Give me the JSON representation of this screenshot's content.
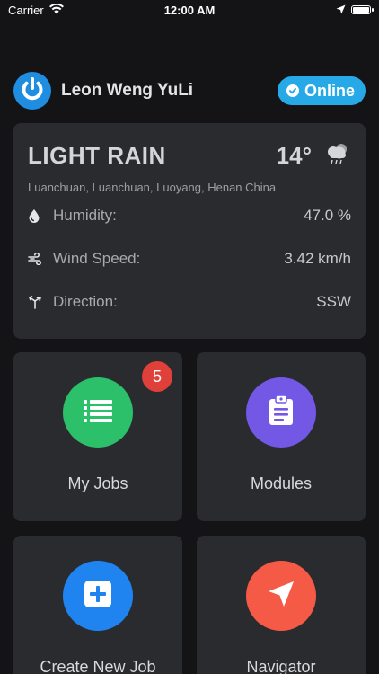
{
  "status_bar": {
    "carrier": "Carrier",
    "time": "12:00 AM",
    "battery_level": 1.0
  },
  "header": {
    "username": "Leon Weng YuLi",
    "status_label": "Online"
  },
  "weather": {
    "condition": "LIGHT RAIN",
    "temperature": "14°",
    "location": "Luanchuan, Luanchuan, Luoyang, Henan China",
    "rows": [
      {
        "icon": "drop-icon",
        "label": "Humidity:",
        "value": "47.0 %"
      },
      {
        "icon": "wind-icon",
        "label": "Wind Speed:",
        "value": "3.42 km/h"
      },
      {
        "icon": "direction-icon",
        "label": "Direction:",
        "value": "SSW"
      }
    ]
  },
  "tiles": [
    {
      "label": "My Jobs",
      "icon": "list-icon",
      "color": "#2cc06b",
      "badge": "5"
    },
    {
      "label": "Modules",
      "icon": "clipboard-icon",
      "color": "#7358e6"
    },
    {
      "label": "Create New Job",
      "icon": "plus-icon",
      "color": "#1f84f0"
    },
    {
      "label": "Navigator",
      "icon": "navigation-arrow-icon",
      "color": "#f45a45"
    }
  ],
  "colors": {
    "background": "#141416",
    "card": "#2a2b2f",
    "online": "#27a9e8",
    "badge": "#e0403a"
  }
}
